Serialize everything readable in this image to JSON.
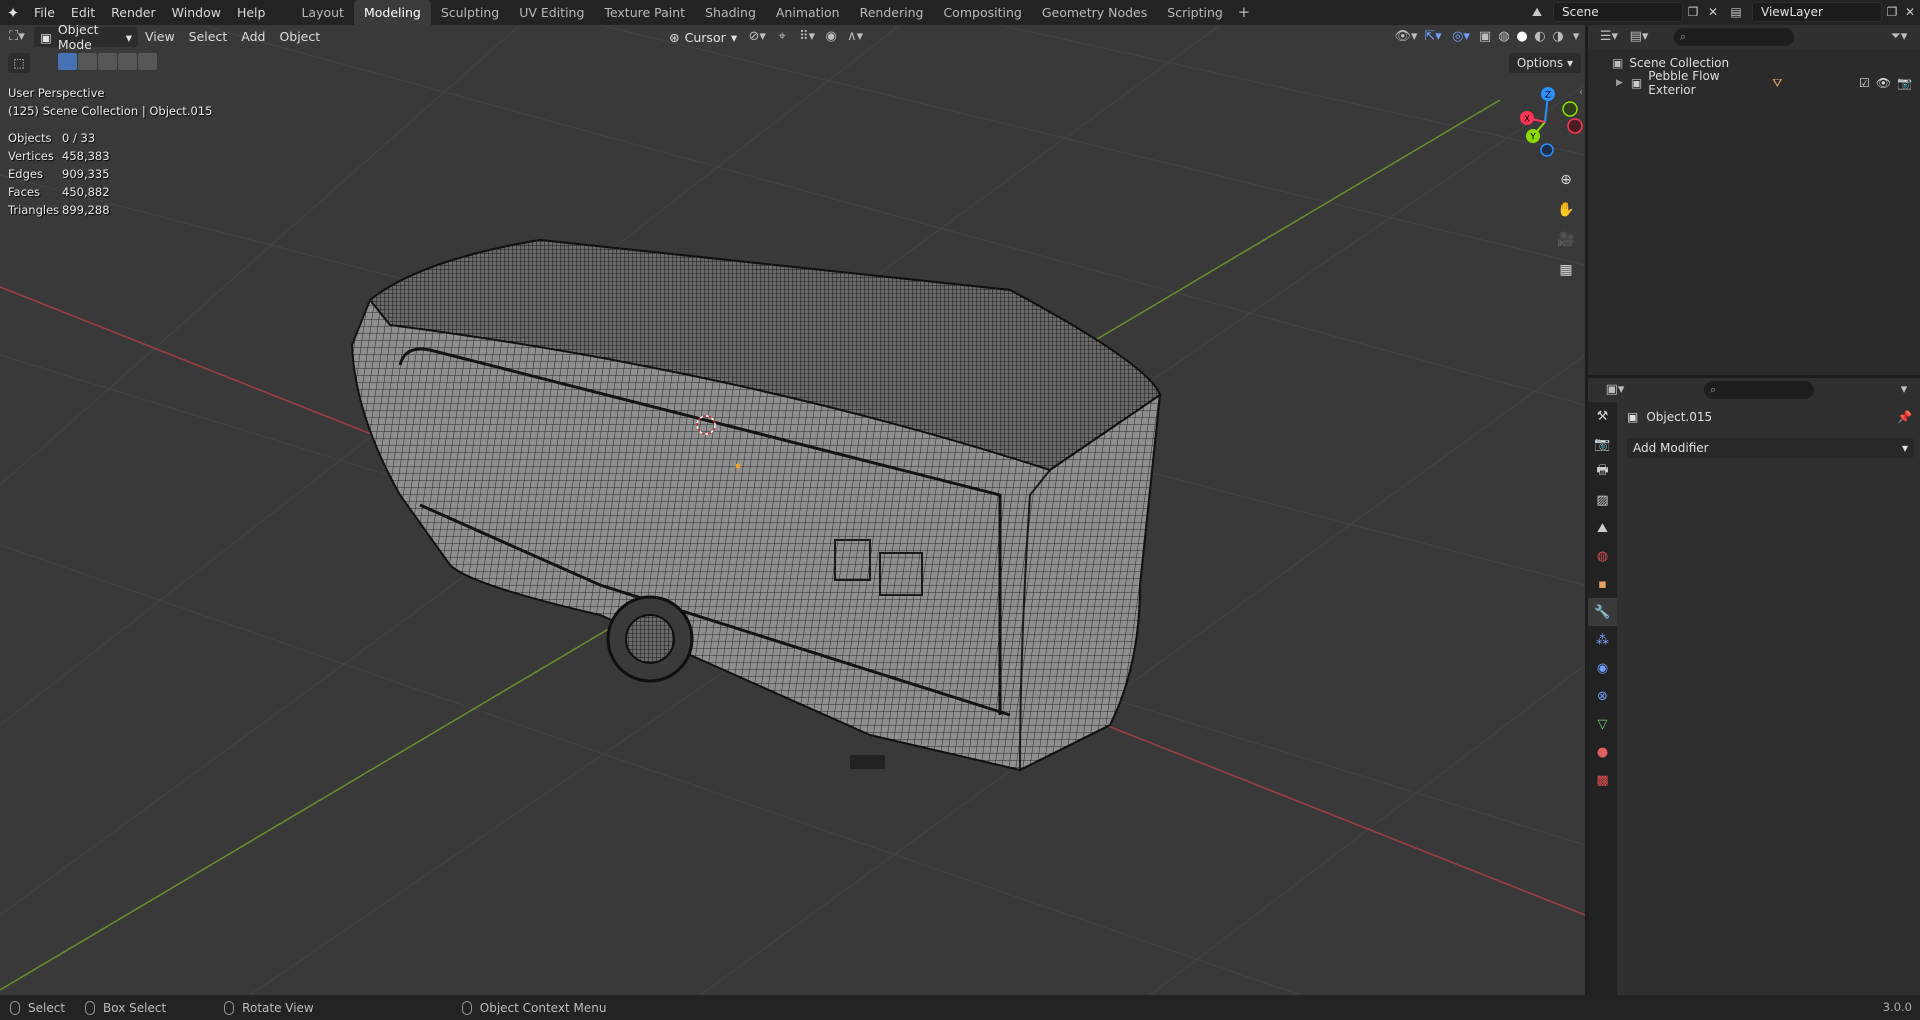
{
  "topbar": {
    "menus": [
      "File",
      "Edit",
      "Render",
      "Window",
      "Help"
    ],
    "workspaces": [
      "Layout",
      "Modeling",
      "Sculpting",
      "UV Editing",
      "Texture Paint",
      "Shading",
      "Animation",
      "Rendering",
      "Compositing",
      "Geometry Nodes",
      "Scripting"
    ],
    "active_workspace": "Modeling",
    "scene_name": "Scene",
    "view_layer": "ViewLayer"
  },
  "viewport": {
    "mode": "Object Mode",
    "menus": [
      "View",
      "Select",
      "Add",
      "Object"
    ],
    "pivot": "Cursor",
    "options_label": "Options",
    "perspective": "User Perspective",
    "collection_info": "(125) Scene Collection | Object.015",
    "stats": [
      {
        "label": "Objects",
        "value": "0 / 33"
      },
      {
        "label": "Vertices",
        "value": "458,383"
      },
      {
        "label": "Edges",
        "value": "909,335"
      },
      {
        "label": "Faces",
        "value": "450,882"
      },
      {
        "label": "Triangles",
        "value": "899,288"
      }
    ],
    "gizmo_axes": {
      "x": "X",
      "y": "Y",
      "z": "Z"
    }
  },
  "outliner": {
    "root": "Scene Collection",
    "items": [
      "Pebble Flow Exterior"
    ]
  },
  "properties": {
    "object_name": "Object.015",
    "add_modifier_label": "Add Modifier"
  },
  "statusbar": {
    "items": [
      "Select",
      "Box Select",
      "Rotate View",
      "Object Context Menu"
    ],
    "version": "3.0.0"
  },
  "colors": {
    "accent": "#4772b3",
    "axis_x": "#ff3352",
    "axis_y": "#8bdc00",
    "axis_z": "#2890ff"
  }
}
